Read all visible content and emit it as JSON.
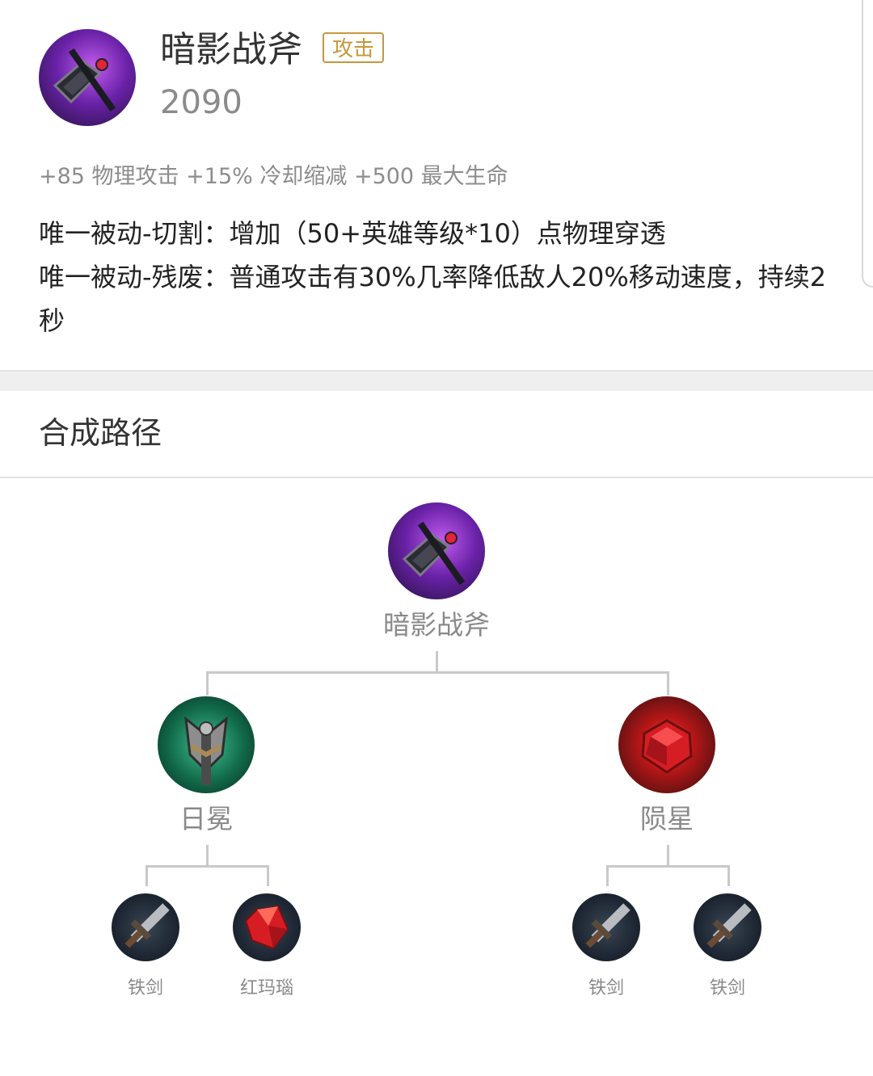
{
  "item": {
    "name": "暗影战斧",
    "tag": "攻击",
    "price": "2090",
    "stats": "+85 物理攻击 +15% 冷却缩减 +500 最大生命",
    "passive_1": "唯一被动-切割：增加（50+英雄等级*10）点物理穿透",
    "passive_2": "唯一被动-残废：普通攻击有30%几率降低敌人20%移动速度，持续2秒"
  },
  "section": {
    "title": "合成路径"
  },
  "tree": {
    "root": {
      "label": "暗影战斧",
      "icon": "shadow-axe-icon"
    },
    "mid_left": {
      "label": "日冕",
      "icon": "sundial-icon"
    },
    "mid_right": {
      "label": "陨星",
      "icon": "meteor-icon"
    },
    "leaves": [
      {
        "label": "铁剑",
        "icon": "iron-sword-icon"
      },
      {
        "label": "红玛瑙",
        "icon": "red-agate-icon"
      },
      {
        "label": "铁剑",
        "icon": "iron-sword-icon"
      },
      {
        "label": "铁剑",
        "icon": "iron-sword-icon"
      }
    ]
  },
  "colors": {
    "badge": "#c6973e",
    "muted_text": "#8a8a8a",
    "connector": "#c9c9c9"
  }
}
